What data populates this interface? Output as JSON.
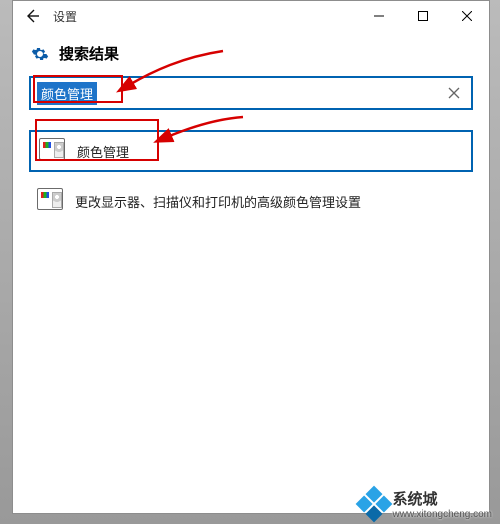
{
  "window": {
    "title": "设置"
  },
  "heading": "搜索结果",
  "search": {
    "value": "颜色管理"
  },
  "results": [
    {
      "label": "颜色管理",
      "selected": true
    },
    {
      "label": "更改显示器、扫描仪和打印机的高级颜色管理设置",
      "selected": false
    }
  ],
  "watermark": {
    "name": "系统城",
    "url": "www.xitongcheng.com"
  }
}
